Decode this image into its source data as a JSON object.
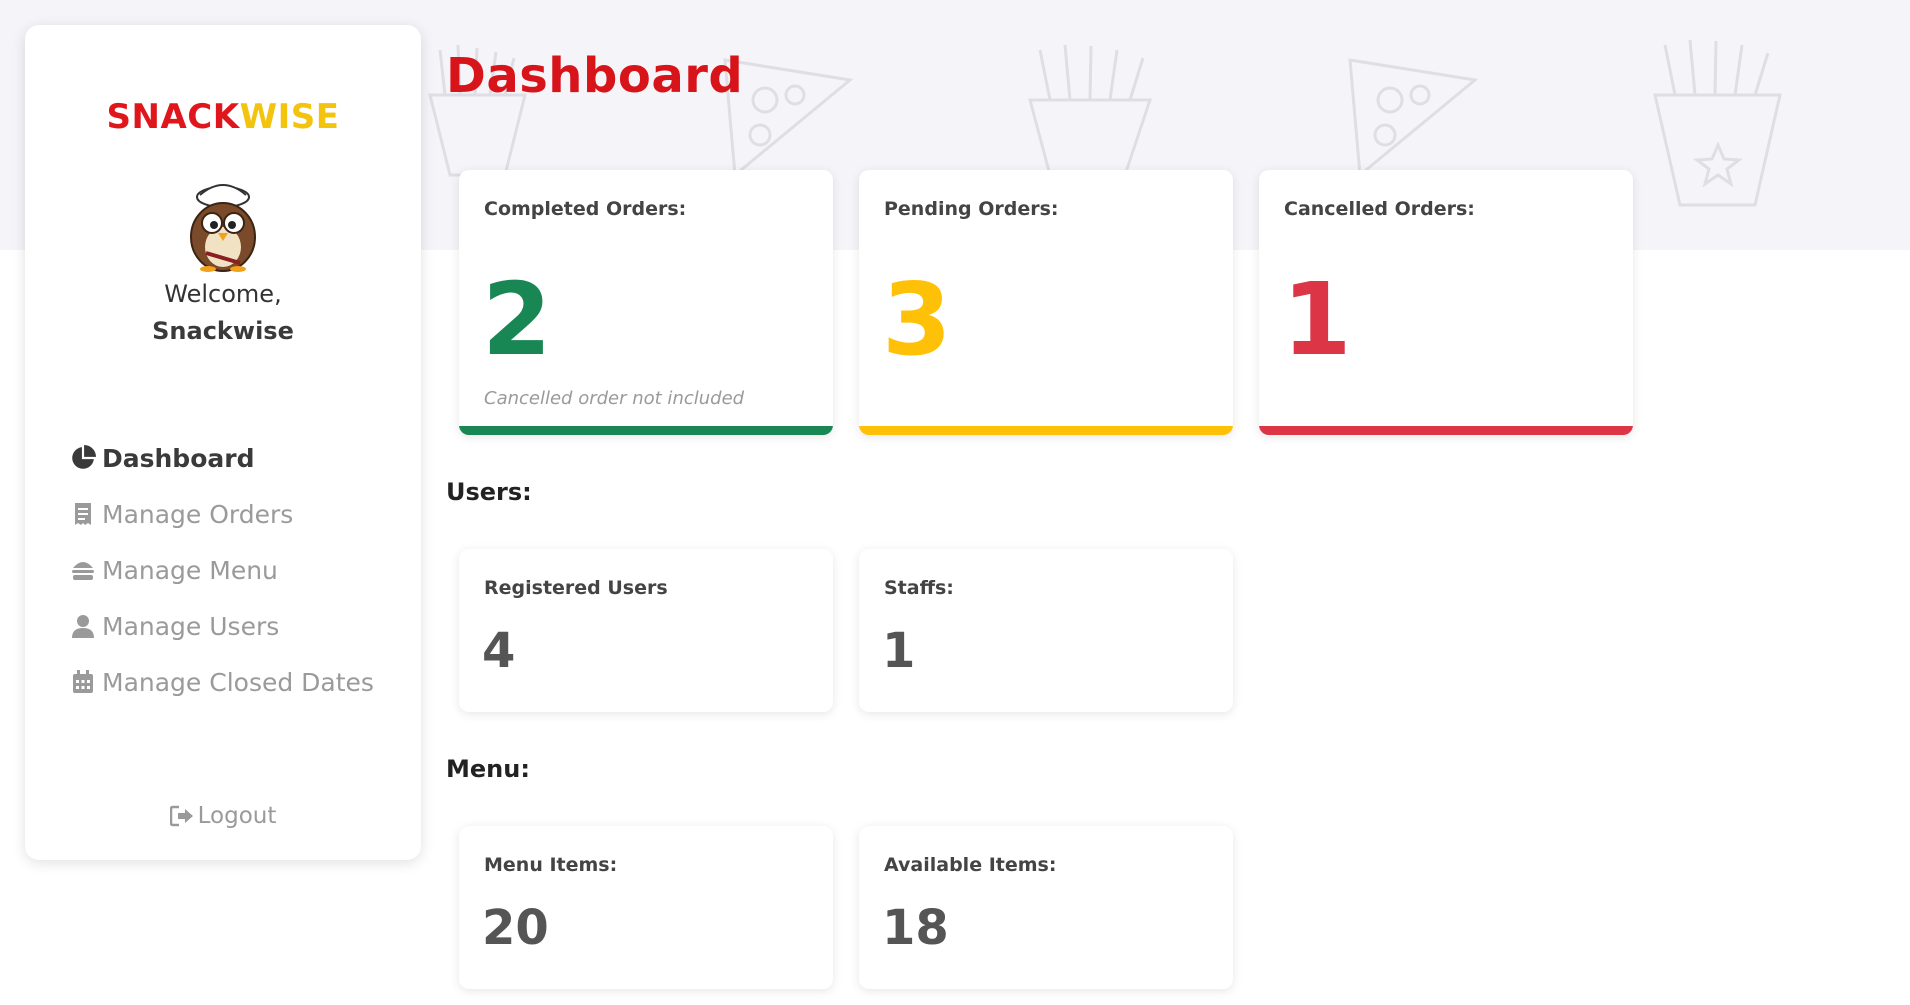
{
  "brand": {
    "part1": "SNACK",
    "part2": "WISE",
    "color1": "#e0161d",
    "color2": "#f3c30e"
  },
  "user": {
    "greeting": "Welcome,",
    "name": "Snackwise"
  },
  "nav": [
    {
      "label": "Dashboard",
      "icon": "pie-chart-icon",
      "active": true
    },
    {
      "label": "Manage Orders",
      "icon": "receipt-icon",
      "active": false
    },
    {
      "label": "Manage Menu",
      "icon": "burger-icon",
      "active": false
    },
    {
      "label": "Manage Users",
      "icon": "user-icon",
      "active": false
    },
    {
      "label": "Manage Closed Dates",
      "icon": "calendar-icon",
      "active": false
    }
  ],
  "logout": {
    "label": "Logout",
    "icon": "logout-icon"
  },
  "page": {
    "title": "Dashboard"
  },
  "orders": {
    "completed": {
      "label": "Completed Orders:",
      "value": "2",
      "note": "Cancelled order not included",
      "color": "#198754"
    },
    "pending": {
      "label": "Pending Orders:",
      "value": "3",
      "color": "#ffc107"
    },
    "cancelled": {
      "label": "Cancelled Orders:",
      "value": "1",
      "color": "#dc3545"
    }
  },
  "users_section": {
    "title": "Users:",
    "registered": {
      "label": "Registered Users",
      "value": "4"
    },
    "staffs": {
      "label": "Staffs:",
      "value": "1"
    }
  },
  "menu_section": {
    "title": "Menu:",
    "items": {
      "label": "Menu Items:",
      "value": "20"
    },
    "available": {
      "label": "Available Items:",
      "value": "18"
    }
  }
}
